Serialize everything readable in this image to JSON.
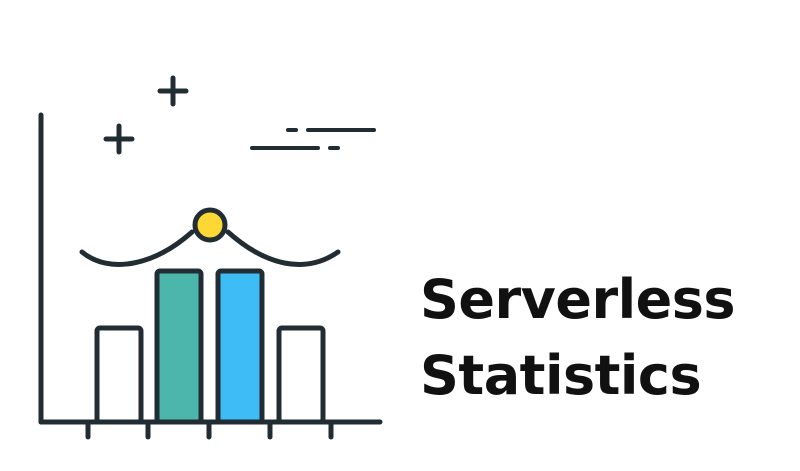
{
  "title": {
    "line1": "Serverless",
    "line2": "Statistics"
  },
  "colors": {
    "ink": "#222c33",
    "teal_bar": "#4db6ac",
    "blue_bar": "#3ebcf5",
    "highlight_dot": "#fdd835",
    "title": "#111111",
    "background": "#ffffff"
  },
  "illustration": {
    "bars": [
      {
        "name": "bar-outline-1",
        "fill": "none"
      },
      {
        "name": "bar-teal",
        "fill": "teal_bar"
      },
      {
        "name": "bar-blue",
        "fill": "blue_bar"
      },
      {
        "name": "bar-outline-4",
        "fill": "none"
      }
    ],
    "icons": [
      "plus-icon",
      "plus-icon",
      "speed-lines-icon",
      "trend-wave-icon",
      "highlight-dot-icon"
    ]
  }
}
